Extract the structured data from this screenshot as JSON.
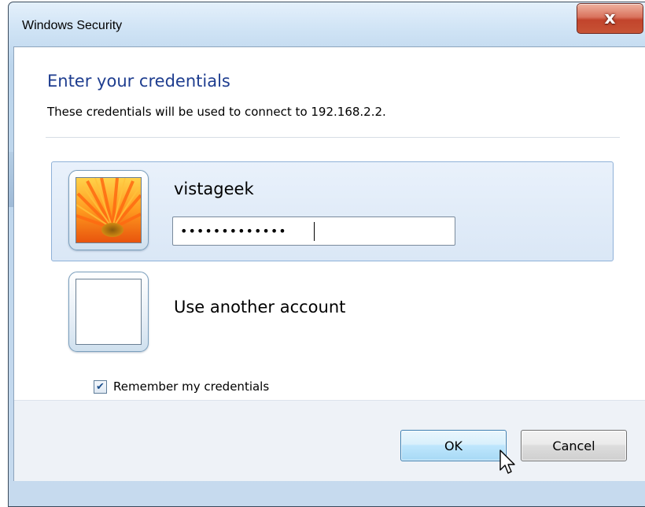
{
  "window": {
    "title": "Windows Security",
    "close_glyph": "x"
  },
  "header": {
    "heading": "Enter your credentials",
    "subtext": "These credentials will be used to connect to 192.168.2.2."
  },
  "accounts": [
    {
      "username": "vistageek",
      "password_masked": "•••••••••••••",
      "avatar": "orange-flower-picture",
      "selected": true
    },
    {
      "label": "Use another account",
      "avatar": "blank-picture",
      "selected": false
    }
  ],
  "remember": {
    "label": "Remember my credentials",
    "checked": true,
    "check_glyph": "✔"
  },
  "buttons": {
    "ok_label": "OK",
    "cancel_label": "Cancel"
  },
  "colors": {
    "heading": "#1e3d8f",
    "close_button": "#c2442c",
    "selected_tile": "#dae7f6"
  }
}
